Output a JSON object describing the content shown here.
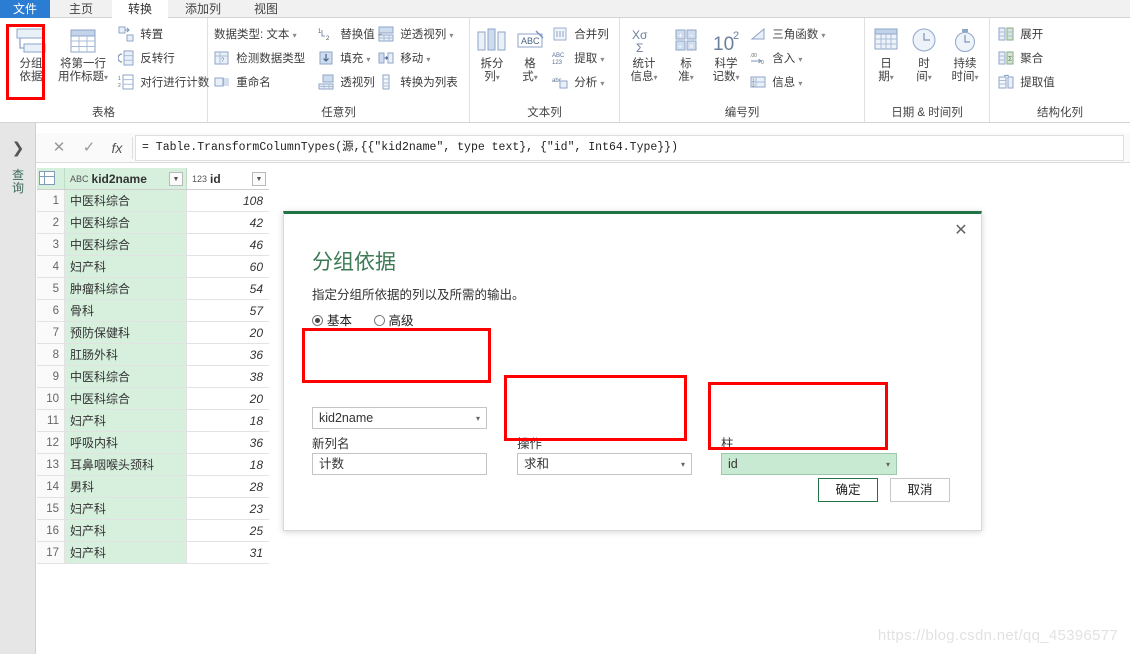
{
  "tabs": [
    {
      "label": "文件",
      "state": "file"
    },
    {
      "label": "主页",
      "state": "normal"
    },
    {
      "label": "转换",
      "state": "active"
    },
    {
      "label": "添加列",
      "state": "normal"
    },
    {
      "label": "视图",
      "state": "normal"
    }
  ],
  "ribbon": {
    "groups": [
      {
        "name": "表格",
        "label": "表格",
        "big": [
          {
            "label1": "分组",
            "label2": "依据",
            "icon": "group-by-icon"
          },
          {
            "label1": "将第一行",
            "label2": "用作标题",
            "icon": "use-first-row-as-header-icon",
            "caret": "▾"
          }
        ],
        "small": [
          {
            "label": "转置",
            "icon": "transpose-icon"
          },
          {
            "label": "反转行",
            "icon": "reverse-rows-icon"
          },
          {
            "label": "对行进行计数",
            "icon": "count-rows-icon"
          }
        ]
      },
      {
        "name": "任意列",
        "label": "任意列",
        "small": [
          {
            "label": "数据类型: 文本",
            "icon": "data-type-icon",
            "caret": "▾"
          },
          {
            "label": "检测数据类型",
            "icon": "detect-data-type-icon"
          },
          {
            "label": "重命名",
            "icon": "rename-icon"
          },
          {
            "label": "替换值",
            "icon": "replace-values-icon",
            "caret": "▾"
          },
          {
            "label": "填充",
            "icon": "fill-icon",
            "caret": "▾"
          },
          {
            "label": "透视列",
            "icon": "pivot-column-icon"
          },
          {
            "label": "逆透视列",
            "icon": "unpivot-column-icon",
            "caret": "▾"
          },
          {
            "label": "移动",
            "icon": "move-icon",
            "caret": "▾"
          },
          {
            "label": "转换为列表",
            "icon": "convert-to-list-icon"
          }
        ]
      },
      {
        "name": "文本列",
        "label": "文本列",
        "big": [
          {
            "label1": "拆分",
            "label2": "列",
            "icon": "split-column-icon",
            "caret": "▾"
          },
          {
            "label1": "格",
            "label2": "式",
            "icon": "format-icon",
            "caret": "▾"
          }
        ],
        "small": [
          {
            "label": "合并列",
            "icon": "merge-columns-icon"
          },
          {
            "label": "提取",
            "icon": "extract-icon",
            "caret": "▾"
          },
          {
            "label": "分析",
            "icon": "parse-icon",
            "caret": "▾"
          }
        ]
      },
      {
        "name": "编号列",
        "label": "编号列",
        "big": [
          {
            "label1": "统计",
            "label2": "信息",
            "icon": "statistics-icon",
            "caret": "▾"
          },
          {
            "label1": "标",
            "label2": "准",
            "icon": "standard-icon",
            "caret": "▾"
          },
          {
            "label1": "科学",
            "label2": "记数",
            "icon": "scientific-icon",
            "caret": "▾"
          }
        ],
        "small": [
          {
            "label": "三角函数",
            "icon": "trigonometry-icon",
            "caret": "▾"
          },
          {
            "label": "含入",
            "icon": "rounding-icon",
            "caret": "▾"
          },
          {
            "label": "信息",
            "icon": "information-icon",
            "caret": "▾"
          }
        ]
      },
      {
        "name": "日期时间列",
        "label": "日期 & 时间列",
        "big": [
          {
            "label1": "日",
            "label2": "期",
            "icon": "date-icon",
            "caret": "▾"
          },
          {
            "label1": "时",
            "label2": "间",
            "icon": "time-icon",
            "caret": "▾"
          },
          {
            "label1": "持续",
            "label2": "时间",
            "icon": "duration-icon",
            "caret": "▾"
          }
        ]
      },
      {
        "name": "结构化列",
        "label": "结构化列",
        "small": [
          {
            "label": "展开",
            "icon": "expand-icon"
          },
          {
            "label": "聚合",
            "icon": "aggregate-icon"
          },
          {
            "label": "提取值",
            "icon": "extract-values-icon"
          }
        ]
      }
    ]
  },
  "formula_bar": {
    "cancel_icon": "✕",
    "accept_icon": "✓",
    "fx_icon": "fx",
    "value": "= Table.TransformColumnTypes(源,{{\"kid2name\", type text}, {\"id\", Int64.Type}})"
  },
  "rail": {
    "chevron": "❯",
    "label": "查询"
  },
  "grid": {
    "columns": [
      {
        "name": "kid2name",
        "type_icon": "ABC",
        "type": "text"
      },
      {
        "name": "id",
        "type_icon": "123",
        "type": "whole-number"
      }
    ],
    "rows": [
      {
        "n": "1",
        "kid2name": "中医科综合",
        "id": "108"
      },
      {
        "n": "2",
        "kid2name": "中医科综合",
        "id": "42"
      },
      {
        "n": "3",
        "kid2name": "中医科综合",
        "id": "46"
      },
      {
        "n": "4",
        "kid2name": "妇产科",
        "id": "60"
      },
      {
        "n": "5",
        "kid2name": "肿瘤科综合",
        "id": "54"
      },
      {
        "n": "6",
        "kid2name": "骨科",
        "id": "57"
      },
      {
        "n": "7",
        "kid2name": "预防保健科",
        "id": "20"
      },
      {
        "n": "8",
        "kid2name": "肛肠外科",
        "id": "36"
      },
      {
        "n": "9",
        "kid2name": "中医科综合",
        "id": "38"
      },
      {
        "n": "10",
        "kid2name": "中医科综合",
        "id": "20"
      },
      {
        "n": "11",
        "kid2name": "妇产科",
        "id": "18"
      },
      {
        "n": "12",
        "kid2name": "呼吸内科",
        "id": "36"
      },
      {
        "n": "13",
        "kid2name": "耳鼻咽喉头颈科",
        "id": "18"
      },
      {
        "n": "14",
        "kid2name": "男科",
        "id": "28"
      },
      {
        "n": "15",
        "kid2name": "妇产科",
        "id": "23"
      },
      {
        "n": "16",
        "kid2name": "妇产科",
        "id": "25"
      },
      {
        "n": "17",
        "kid2name": "妇产科",
        "id": "31"
      }
    ]
  },
  "dialog": {
    "title": "分组依据",
    "subtitle": "指定分组所依据的列以及所需的输出。",
    "close_icon": "✕",
    "mode_options": [
      {
        "label": "基本",
        "selected": true
      },
      {
        "label": "高级",
        "selected": false
      }
    ],
    "group_by_column": {
      "value": "kid2name",
      "arrow": "▾"
    },
    "new_column_name": {
      "label": "新列名",
      "value": "计数"
    },
    "operation": {
      "label": "操作",
      "value": "求和",
      "arrow": "▾"
    },
    "column": {
      "label": "柱",
      "value": "id",
      "arrow": "▾"
    },
    "ok_button": "确定",
    "cancel_button": "取消"
  },
  "watermark": "https://blog.csdn.net/qq_45396577",
  "colors": {
    "accent_green": "#217346",
    "title_green": "#3d7a55",
    "selection_green": "#c8ead3",
    "header_green": "#d7efdd",
    "annotation_red": "#ff0000",
    "file_tab_blue": "#2b7cd3"
  }
}
